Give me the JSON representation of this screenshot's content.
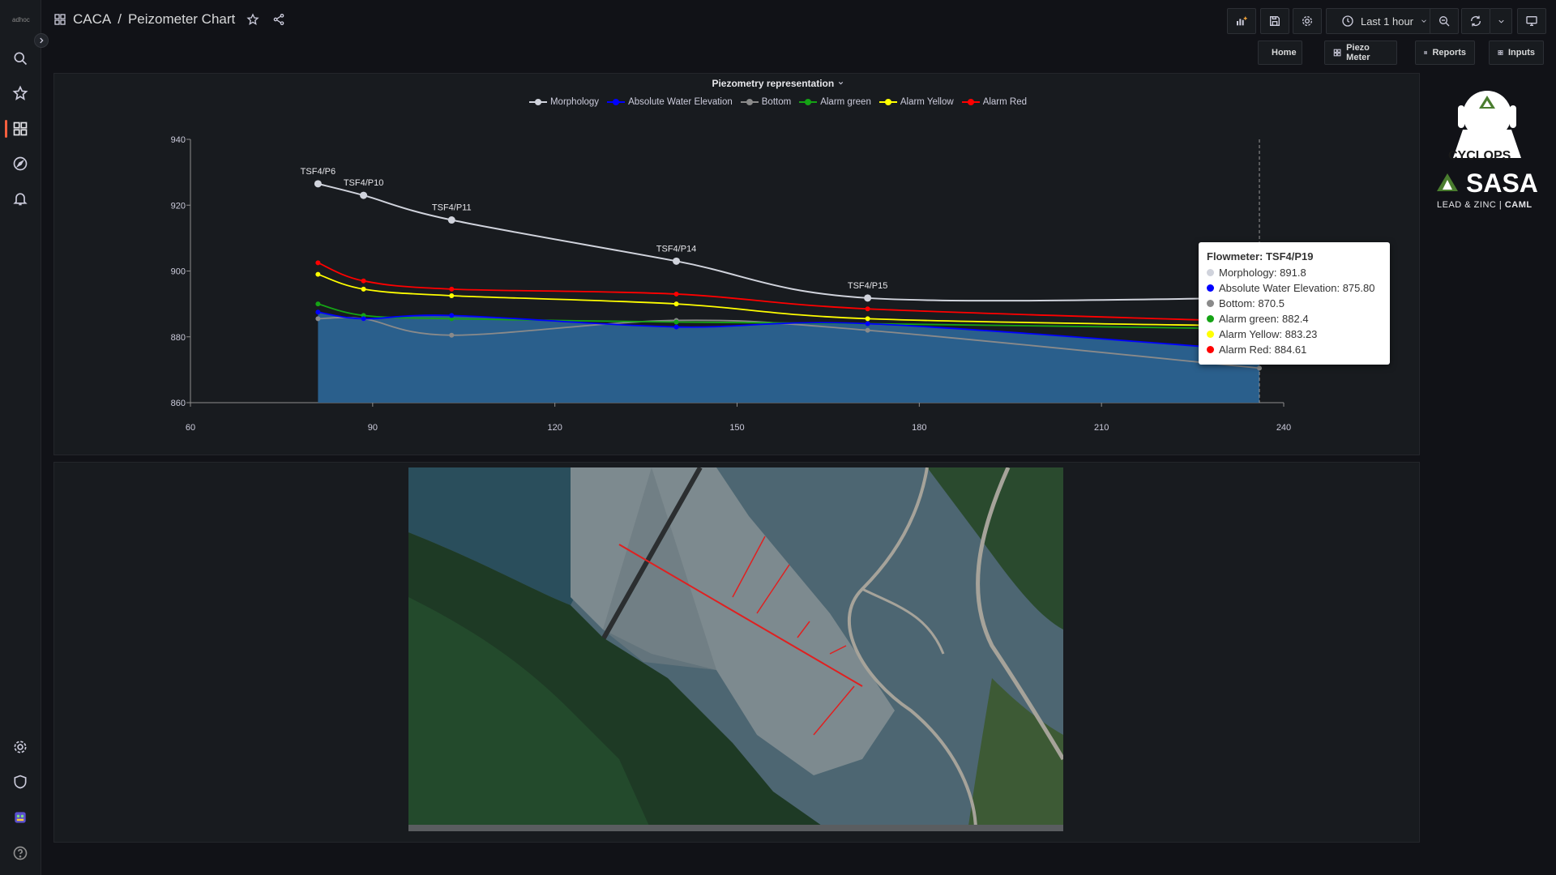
{
  "nav": {
    "logo_text": "adhoc",
    "icons": [
      "search-icon",
      "star-icon",
      "dashboards-icon",
      "explore-icon",
      "alert-bell-icon",
      "gear-icon",
      "shield-icon",
      "plugin-app-icon",
      "help-icon"
    ]
  },
  "breadcrumb": {
    "folder": "CACA",
    "separator": "/",
    "title": "Peizometer Chart"
  },
  "toolbar": {
    "time_range": "Last 1 hour"
  },
  "links": [
    "Home",
    "Piezo Meter",
    "Reports",
    "Inputs"
  ],
  "colors": {
    "morphology": "#d0d3dc",
    "water": "#0000ff",
    "bottom": "#8a8a8a",
    "alarm_green": "#15a315",
    "alarm_yellow": "#ffff00",
    "alarm_red": "#ff0000",
    "water_fill": "#2a5f8c",
    "accent": "#f55f3e"
  },
  "chart_data": {
    "type": "line",
    "title": "Piezometry representation",
    "xlim": [
      60,
      240
    ],
    "ylim": [
      860,
      940
    ],
    "xticks": [
      60,
      90,
      120,
      150,
      180,
      210,
      240
    ],
    "yticks": [
      860,
      880,
      900,
      920,
      940
    ],
    "legend_position": "top-center",
    "series": [
      {
        "name": "Morphology",
        "key": "morphology",
        "x": [
          81,
          88.5,
          103,
          140,
          171.5,
          236
        ],
        "y": [
          926.5,
          923,
          915.5,
          903,
          891.8,
          891.8
        ]
      },
      {
        "name": "Absolute Water Elevation",
        "key": "water",
        "x": [
          81,
          88.5,
          103,
          140,
          171.5,
          236
        ],
        "y": [
          887.5,
          885.5,
          886.5,
          883,
          884,
          875.8
        ]
      },
      {
        "name": "Bottom",
        "key": "bottom",
        "x": [
          81,
          88.5,
          103,
          140,
          171.5,
          236
        ],
        "y": [
          885.5,
          885.5,
          880.5,
          885,
          882,
          870.5
        ]
      },
      {
        "name": "Alarm green",
        "key": "alarm_green",
        "x": [
          81,
          88.5,
          103,
          140,
          171.5,
          236
        ],
        "y": [
          890,
          886.5,
          885.5,
          884.5,
          884,
          882.4
        ]
      },
      {
        "name": "Alarm Yellow",
        "key": "alarm_yellow",
        "x": [
          81,
          88.5,
          103,
          140,
          171.5,
          236
        ],
        "y": [
          899,
          894.5,
          892.5,
          890,
          885.5,
          883.23
        ]
      },
      {
        "name": "Alarm Red",
        "key": "alarm_red",
        "x": [
          81,
          88.5,
          103,
          140,
          171.5,
          236
        ],
        "y": [
          902.5,
          897,
          894.5,
          893,
          888.5,
          884.61
        ]
      }
    ],
    "point_labels": [
      {
        "text": "TSF4/P6",
        "x": 81,
        "y": 926.5
      },
      {
        "text": "TSF4/P10",
        "x": 88.5,
        "y": 923
      },
      {
        "text": "TSF4/P11",
        "x": 103,
        "y": 915.5
      },
      {
        "text": "TSF4/P14",
        "x": 140,
        "y": 903
      },
      {
        "text": "TSF4/P15",
        "x": 171.5,
        "y": 891.8
      }
    ],
    "cursor_x": 236
  },
  "tooltip": {
    "title": "Flowmeter: TSF4/P19",
    "rows": [
      {
        "label": "Morphology: 891.8",
        "color": "#d0d3dc"
      },
      {
        "label": "Absolute Water Elevation: 875.80",
        "color": "#0000ff"
      },
      {
        "label": "Bottom: 870.5",
        "color": "#8a8a8a"
      },
      {
        "label": "Alarm green: 882.4",
        "color": "#15a315"
      },
      {
        "label": "Alarm Yellow: 883.23",
        "color": "#ffff00"
      },
      {
        "label": "Alarm Red: 884.61",
        "color": "#ff0000"
      }
    ]
  },
  "logo": {
    "brand": "CYCLOPS",
    "company": "SASA",
    "tagline": "LEAD & ZINC",
    "partner": "CAML"
  }
}
